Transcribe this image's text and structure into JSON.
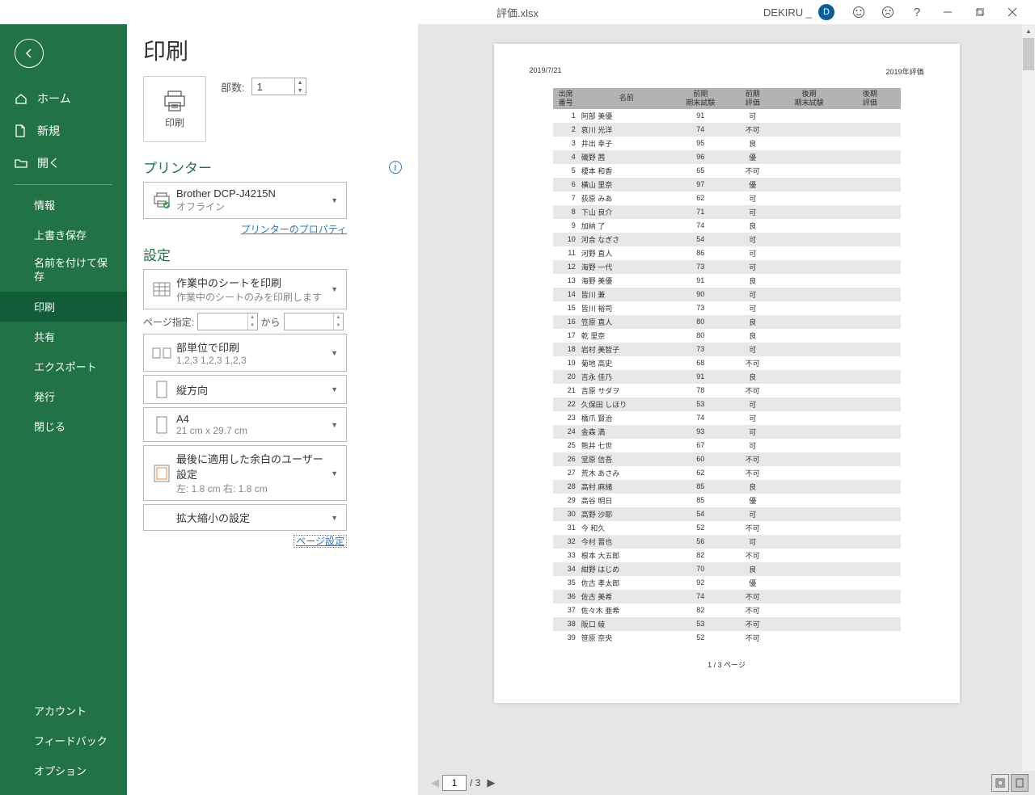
{
  "titlebar": {
    "filename": "評価.xlsx",
    "username": "DEKIRU _",
    "avatar": "D",
    "help": "?"
  },
  "sidebar": {
    "top": [
      {
        "label": "ホーム",
        "icon": "home"
      },
      {
        "label": "新規",
        "icon": "new"
      },
      {
        "label": "開く",
        "icon": "open"
      }
    ],
    "sub": [
      "情報",
      "上書き保存",
      "名前を付けて保存",
      "印刷",
      "共有",
      "エクスポート",
      "発行",
      "閉じる"
    ],
    "active": "印刷",
    "bottom": [
      "アカウント",
      "フィードバック",
      "オプション"
    ]
  },
  "print": {
    "heading": "印刷",
    "button_label": "印刷",
    "copies_label": "部数:",
    "copies_value": "1",
    "printer_heading": "プリンター",
    "printer_name": "Brother DCP-J4215N",
    "printer_status": "オフライン",
    "printer_props": "プリンターのプロパティ",
    "settings_heading": "設定",
    "setting_sheets_l1": "作業中のシートを印刷",
    "setting_sheets_l2": "作業中のシートのみを印刷します",
    "page_range_label": "ページ指定:",
    "page_range_to": "から",
    "collate_l1": "部単位で印刷",
    "collate_l2": "1,2,3    1,2,3    1,2,3",
    "orientation": "縦方向",
    "paper_l1": "A4",
    "paper_l2": "21 cm x 29.7 cm",
    "margins_l1": "最後に適用した余白のユーザー設定",
    "margins_l2": "左: 1.8 cm    右: 1.8 cm",
    "scaling": "拡大縮小の設定",
    "page_setup": "ページ設定"
  },
  "preview": {
    "date": "2019/7/21",
    "title": "2019年評価",
    "headers": [
      "出席\n番号",
      "名前",
      "前期\n期末試験",
      "前期\n評価",
      "後期\n期末試験",
      "後期\n評価"
    ],
    "rows": [
      [
        "1",
        "阿部 美優",
        "91",
        "可"
      ],
      [
        "2",
        "哀川 光洋",
        "74",
        "不可"
      ],
      [
        "3",
        "井出 幸子",
        "95",
        "良"
      ],
      [
        "4",
        "磯野 茜",
        "96",
        "優"
      ],
      [
        "5",
        "榎本 和香",
        "65",
        "不可"
      ],
      [
        "6",
        "横山 里奈",
        "97",
        "優"
      ],
      [
        "7",
        "荻原 みあ",
        "62",
        "可"
      ],
      [
        "8",
        "下山 良介",
        "71",
        "可"
      ],
      [
        "9",
        "加納 了",
        "74",
        "良"
      ],
      [
        "10",
        "河合 なぎさ",
        "54",
        "可"
      ],
      [
        "11",
        "河野 直人",
        "86",
        "可"
      ],
      [
        "12",
        "海野 一代",
        "73",
        "可"
      ],
      [
        "13",
        "海野 美優",
        "91",
        "良"
      ],
      [
        "14",
        "皆川 兼",
        "90",
        "可"
      ],
      [
        "15",
        "皆川 裕司",
        "73",
        "可"
      ],
      [
        "16",
        "笠原 直人",
        "80",
        "良"
      ],
      [
        "17",
        "乾 里奈",
        "80",
        "良"
      ],
      [
        "18",
        "岩村 美智子",
        "73",
        "可"
      ],
      [
        "19",
        "菊地 高史",
        "68",
        "不可"
      ],
      [
        "20",
        "吉永 佳乃",
        "91",
        "良"
      ],
      [
        "21",
        "吉原 サダヲ",
        "78",
        "不可"
      ],
      [
        "22",
        "久保田 しほり",
        "53",
        "可"
      ],
      [
        "23",
        "橋爪 賢治",
        "74",
        "可"
      ],
      [
        "24",
        "金森 満",
        "93",
        "可"
      ],
      [
        "25",
        "熊井 七世",
        "67",
        "可"
      ],
      [
        "26",
        "堂原 信吾",
        "60",
        "不可"
      ],
      [
        "27",
        "荒木 あさみ",
        "62",
        "不可"
      ],
      [
        "28",
        "高村 麻緒",
        "85",
        "良"
      ],
      [
        "29",
        "高谷 明日",
        "85",
        "優"
      ],
      [
        "30",
        "高野 沙耶",
        "54",
        "可"
      ],
      [
        "31",
        "今 和久",
        "52",
        "不可"
      ],
      [
        "32",
        "今村 晋也",
        "56",
        "可"
      ],
      [
        "33",
        "根本 大五郎",
        "82",
        "不可"
      ],
      [
        "34",
        "紺野 はじめ",
        "70",
        "良"
      ],
      [
        "35",
        "佐古 孝太郎",
        "92",
        "優"
      ],
      [
        "36",
        "佐古 美希",
        "74",
        "不可"
      ],
      [
        "37",
        "佐々木 亜希",
        "82",
        "不可"
      ],
      [
        "38",
        "阪口 綾",
        "53",
        "不可"
      ],
      [
        "39",
        "笹原 奈央",
        "52",
        "不可"
      ]
    ],
    "footer": "1 / 3 ページ",
    "nav": {
      "current": "1",
      "total": "/ 3"
    }
  }
}
